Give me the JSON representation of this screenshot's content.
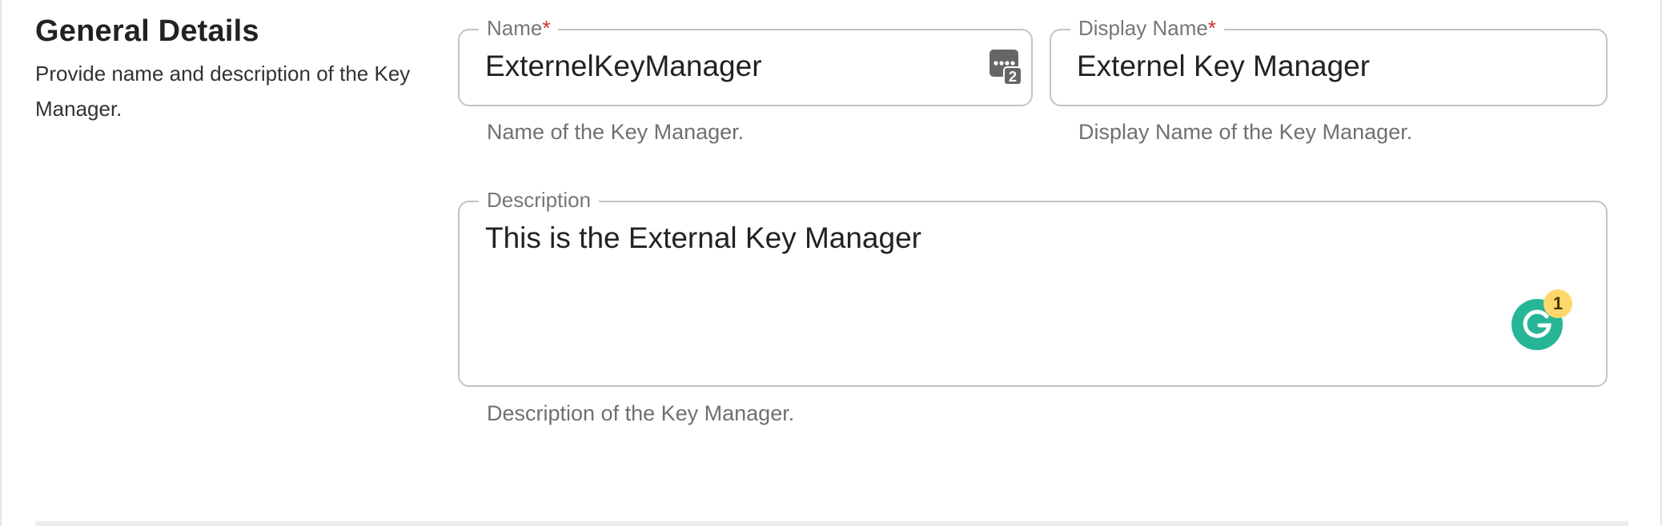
{
  "section": {
    "title": "General Details",
    "description": "Provide name and description of the Key Manager."
  },
  "fields": {
    "name": {
      "label": "Name",
      "required_mark": "*",
      "value": "ExternelKeyManager",
      "helper": "Name of the Key Manager.",
      "icon": "password-manager-icon",
      "icon_badge": "2"
    },
    "display_name": {
      "label": "Display Name",
      "required_mark": "*",
      "value": "Externel Key Manager",
      "helper": "Display Name of the Key Manager."
    },
    "description": {
      "label": "Description",
      "value": "This is the External Key Manager",
      "helper": "Description of the Key Manager."
    }
  },
  "grammarly": {
    "icon": "grammarly-icon",
    "badge_count": "1",
    "color": "#27b597",
    "badge_color": "#ffd86b"
  },
  "colors": {
    "required": "#d32f2f",
    "border": "#c4c4c4",
    "helper_text": "#707070"
  }
}
